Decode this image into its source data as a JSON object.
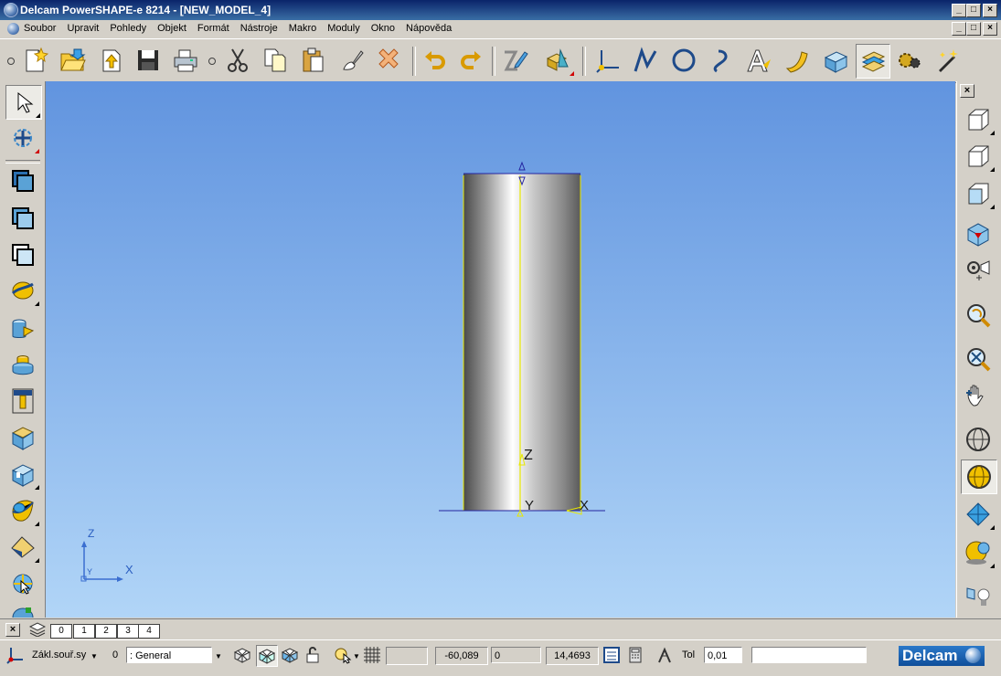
{
  "window": {
    "title": "Delcam PowerSHAPE-e 8214 - [NEW_MODEL_4]",
    "controls": [
      "_",
      "□",
      "×"
    ]
  },
  "menu": [
    "Soubor",
    "Upravit",
    "Pohledy",
    "Objekt",
    "Formát",
    "Nástroje",
    "Makro",
    "Moduly",
    "Okno",
    "Nápověda"
  ],
  "toolbar": {
    "icons": [
      "new-model-icon",
      "open-model-icon",
      "import-icon",
      "save-icon",
      "print-icon",
      "cut-icon",
      "copy-icon",
      "paste-icon",
      "erase-icon",
      "delete-icon",
      "undo-icon",
      "redo-icon",
      "general-edit-icon",
      "solid-feature-icon",
      "workplane-icon",
      "line-icon",
      "arc-icon",
      "curve-icon",
      "text-icon",
      "surface-icon",
      "solid-icon",
      "electrode-icon",
      "toolmaker-icon",
      "wizard-icon"
    ]
  },
  "left_toolbar": {
    "icons": [
      "select-icon",
      "transform-icon",
      "workplane-icon",
      "offset-icon",
      "primitive-icon",
      "surface-plane-icon",
      "solid-extrude-icon",
      "cylinder-icon",
      "component-icon",
      "library-icon",
      "block-icon",
      "assembly-icon",
      "shading-icon",
      "measure-icon"
    ]
  },
  "right_toolbar": {
    "close": "×",
    "icons": [
      "view-top-icon",
      "view-iso-icon",
      "view-front-icon",
      "view-3d-icon",
      "view-rotate-icon",
      "zoom-rotate-icon",
      "zoom-all-icon",
      "pan-icon",
      "wireframe-icon",
      "shaded-icon",
      "translucent-icon",
      "material-icon",
      "lighting-icon"
    ]
  },
  "viewport": {
    "model_labels": {
      "z": "Z",
      "y": "Y",
      "x": "X"
    },
    "triad": {
      "z": "Z",
      "y": "Y",
      "x": "X"
    },
    "colors": {
      "background_top": "#6194df",
      "background_bottom": "#b1d5f7",
      "cylinder": "#9a9a9a",
      "edge": "#ffff00",
      "axis": "#2a2aa0"
    }
  },
  "levels": {
    "close": "×",
    "tabs": [
      "0",
      "1",
      "2",
      "3",
      "4"
    ]
  },
  "status": {
    "workplane": "Zákl.souř.sy",
    "level_value": "0",
    "level_name": ": General",
    "x": "-60,089",
    "y": "0",
    "z": "14,4693",
    "tol_label": "Tol",
    "tol_value": "0,01",
    "logo": "Delcam"
  }
}
